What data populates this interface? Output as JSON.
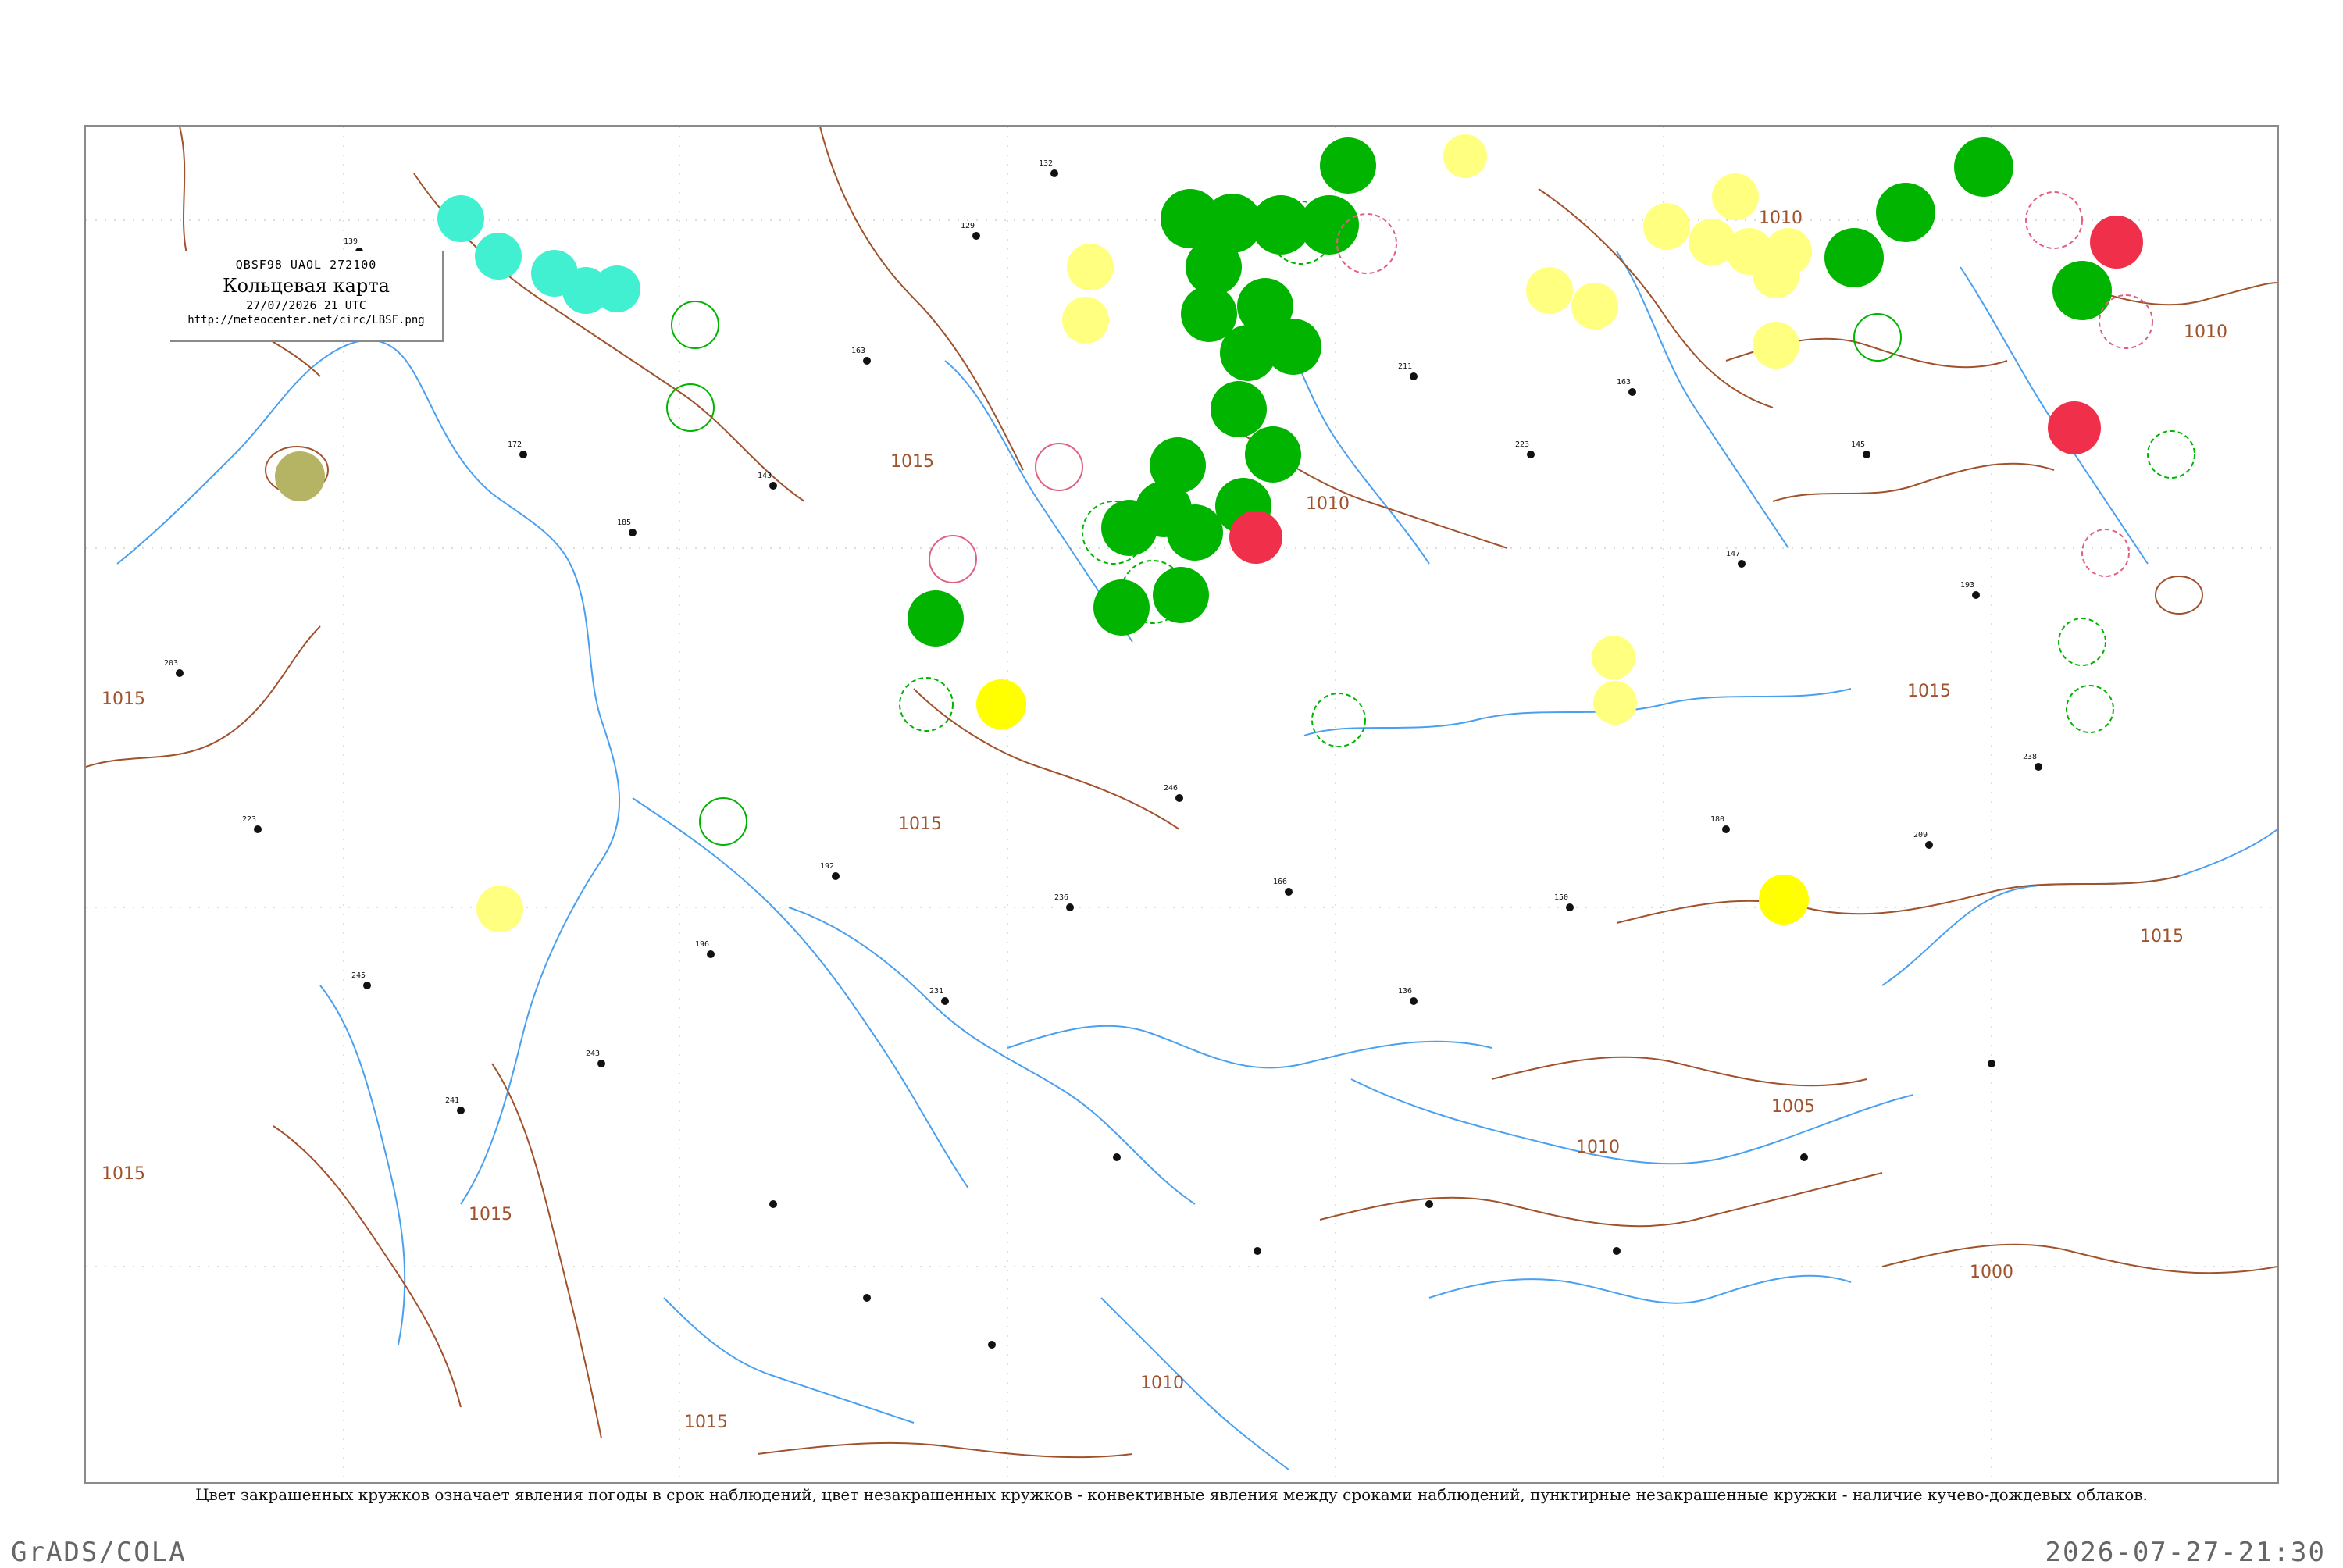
{
  "header": {
    "code": "QBSF98  UAOL  272100",
    "title": "Кольцевая карта",
    "time": "27/07/2026 21 UTC",
    "url": "http://meteocenter.net/circ/LBSF.png"
  },
  "caption": "Цвет закрашенных кружков означает явления погоды в срок наблюдений, цвет незакрашенных кружков - конвективные явления между сроками наблюдений, пунктирные незакрашенные кружки - наличие кучево-дождевых облаков.",
  "footer": {
    "left": "GrADS/COLA",
    "right": "2026-07-27-21:30"
  },
  "isobar_labels": [
    "1010",
    "1015",
    "1015",
    "1015",
    "1015",
    "1010",
    "1010",
    "1015",
    "1005",
    "1010",
    "1000",
    "1010",
    "1015",
    "1015",
    "1015"
  ],
  "colors": {
    "thunder": "#00b400",
    "rain_light": "#ffff80",
    "rain": "#ffff00",
    "fog": "#40f0d0",
    "heavy": "#f0304a",
    "haze": "#b4b464",
    "isobar": "#a0522d",
    "water": "#4aa0f0"
  },
  "legend_icons": [
    "thunderstorm-circle-icon",
    "rain-circle-icon",
    "fog-circle-icon",
    "heavy-precip-circle-icon",
    "haze-circle-icon",
    "convective-ring-icon",
    "cb-dashed-ring-icon"
  ]
}
